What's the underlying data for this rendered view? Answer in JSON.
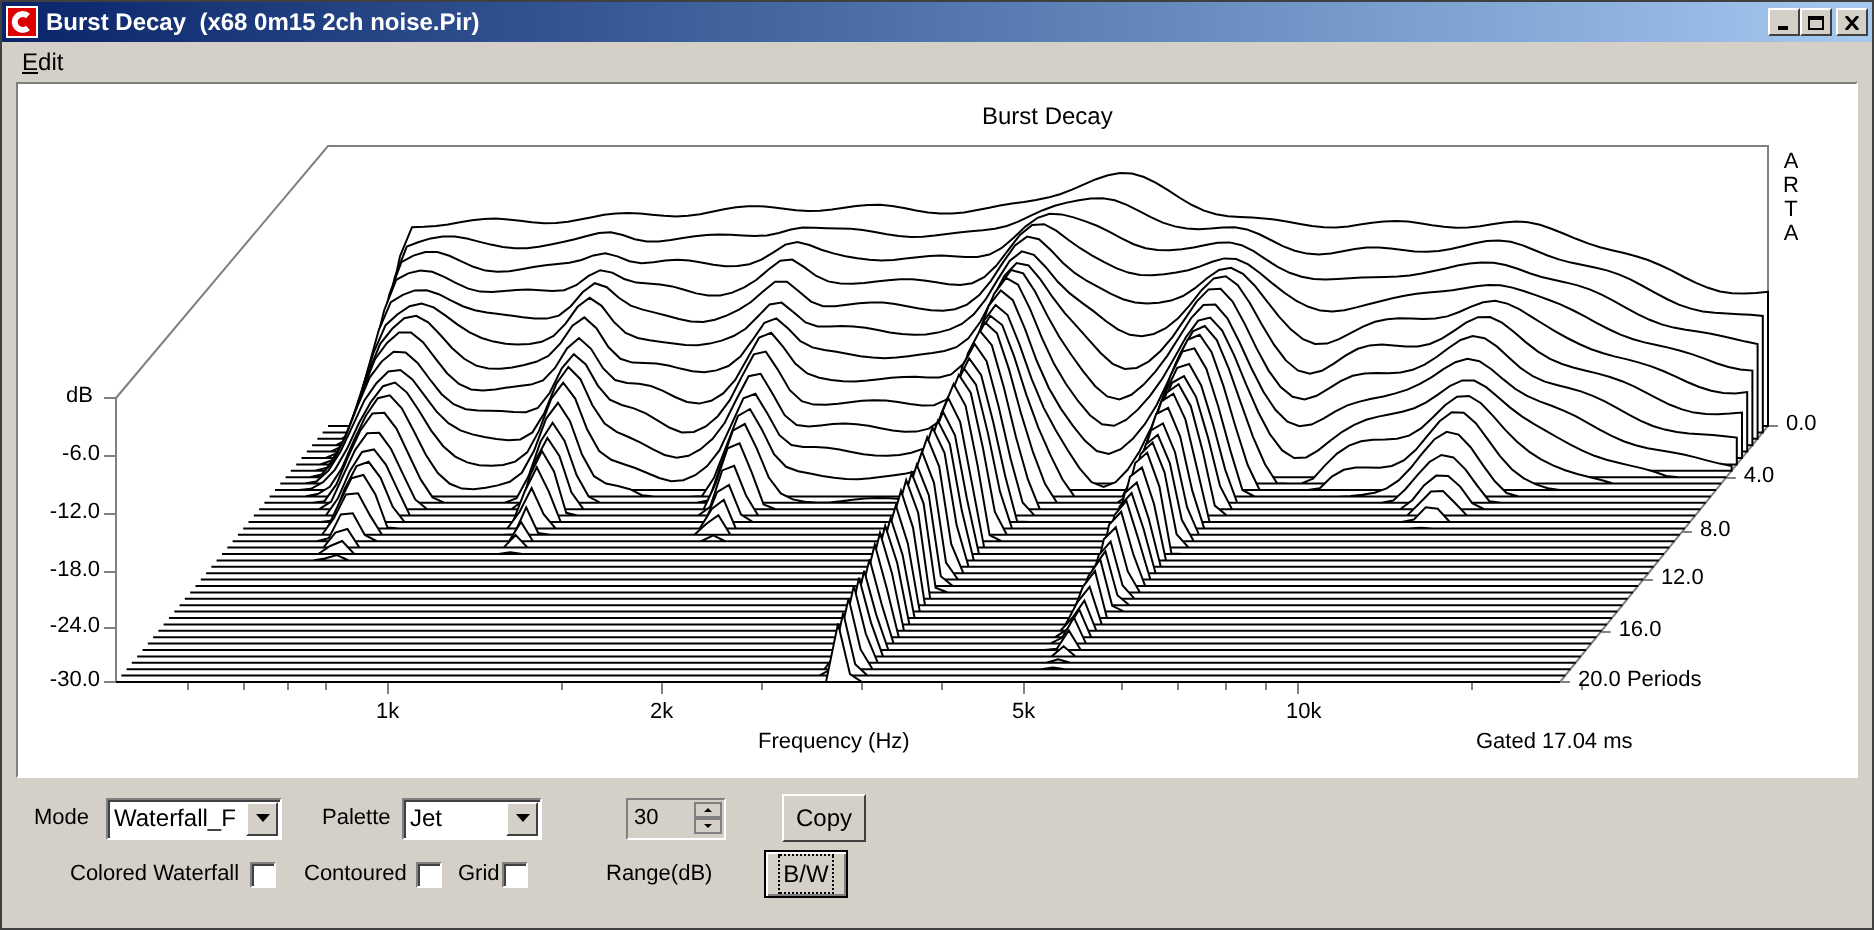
{
  "window": {
    "title": "Burst Decay  (x68 0m15 2ch noise.Pir)"
  },
  "menu": [
    {
      "label": "Edit"
    }
  ],
  "plot": {
    "title": "Burst Decay",
    "logo": "ARTA",
    "y_label": "dB",
    "y_ticks": [
      "-6.0",
      "-12.0",
      "-18.0",
      "-24.0",
      "-30.0"
    ],
    "x_ticks": [
      "1k",
      "2k",
      "5k",
      "10k"
    ],
    "x_label": "Frequency (Hz)",
    "depth_ticks": [
      "0.0",
      "4.0",
      "8.0",
      "12.0",
      "16.0",
      "20.0 Periods"
    ],
    "note": "Gated 17.04 ms"
  },
  "controls": {
    "mode": {
      "label": "Mode",
      "value": "Waterfall_F"
    },
    "palette": {
      "label": "Palette",
      "value": "Jet"
    },
    "range": {
      "value": "30",
      "label": "Range(dB)"
    },
    "buttons": [
      {
        "label": "Copy",
        "focused": false
      },
      {
        "label": "B/W",
        "focused": true
      }
    ],
    "checkboxes": [
      {
        "label": "Colored Waterfall",
        "checked": false
      },
      {
        "label": "Contoured",
        "checked": false
      },
      {
        "label": "Grid",
        "checked": false
      }
    ]
  }
}
